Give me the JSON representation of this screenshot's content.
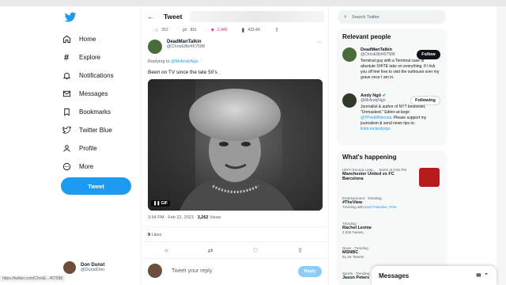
{
  "nav": {
    "items": [
      {
        "label": "Home",
        "icon": "home-icon"
      },
      {
        "label": "Explore",
        "icon": "hashtag-icon"
      },
      {
        "label": "Notifications",
        "icon": "bell-icon"
      },
      {
        "label": "Messages",
        "icon": "envelope-icon"
      },
      {
        "label": "Bookmarks",
        "icon": "bookmark-icon"
      },
      {
        "label": "Twitter Blue",
        "icon": "twitter-blue-icon"
      },
      {
        "label": "Profile",
        "icon": "person-icon"
      },
      {
        "label": "More",
        "icon": "more-circle-icon"
      }
    ],
    "tweet_button": "Tweet"
  },
  "account": {
    "name": "Don Dunst",
    "handle": "@DunstDon"
  },
  "status_url": "https://twitter.com/ChrisE...457588",
  "header": {
    "title": "Tweet"
  },
  "stats": {
    "replies": "353",
    "retweets": "891",
    "likes": "2,440",
    "views": "433.4K"
  },
  "tweet": {
    "author_name": "DeadManTalkin",
    "author_handle": "@ChrisE8bI457588",
    "reply_prefix": "Replying to",
    "reply_handle": "@MrAndyNgo",
    "text": "Been on TV since the late 50's",
    "gif_label": "GIF",
    "time": "3:54 PM · Feb 22, 2023 · ",
    "views_count": "3,262",
    "views_label": " Views",
    "likes_count": "9",
    "likes_label": " Likes"
  },
  "reply": {
    "placeholder": "Tweet your reply",
    "button": "Reply"
  },
  "search": {
    "placeholder": "Search Twitter"
  },
  "relevant": {
    "title": "Relevant people",
    "people": [
      {
        "name": "DeadManTalkin",
        "handle": "@ChrisE8bI457588",
        "bio": "Terminal guy with a Terminal case of absolute SHITE take on everything. If I tick you off feel free to visit the outhouse over my grave once I am in.",
        "button": "Follow"
      },
      {
        "name": "Andy Ngô",
        "handle": "@MrAndyNgo",
        "bio_pre": "Journalist & author of NYT bestseller, \"Unmasked.\" Editor-at-large ",
        "bio_link1": "@TPostMillennial",
        "bio_mid": ". Please support my journalism & send news tips to: ",
        "bio_link2": "linktr.ee/andyngo",
        "button": "Following"
      }
    ]
  },
  "happening": {
    "title": "What's happening",
    "trends": [
      {
        "context": "UEFA Europa Leag... · Starts at 3:00 PM",
        "name": "Manchester United vs FC Barcelona",
        "sub": ""
      },
      {
        "context": "Entertainment · Trending",
        "name": "#TheView",
        "sub_pre": "Trending with ",
        "sub_link": "East Palestine, Pete"
      },
      {
        "context": "Trending",
        "name": "Rachel Levine",
        "sub": "2,006 Tweets"
      },
      {
        "context": "News · Trending",
        "name": "MSNBC",
        "sub": "51.2K Tweets"
      },
      {
        "context": "Sports · Trending",
        "name": "Jason Peters",
        "sub": ""
      }
    ]
  },
  "messages": {
    "label": "Messages"
  },
  "colors": {
    "accent": "#1d9bf0",
    "like": "#f91880"
  }
}
